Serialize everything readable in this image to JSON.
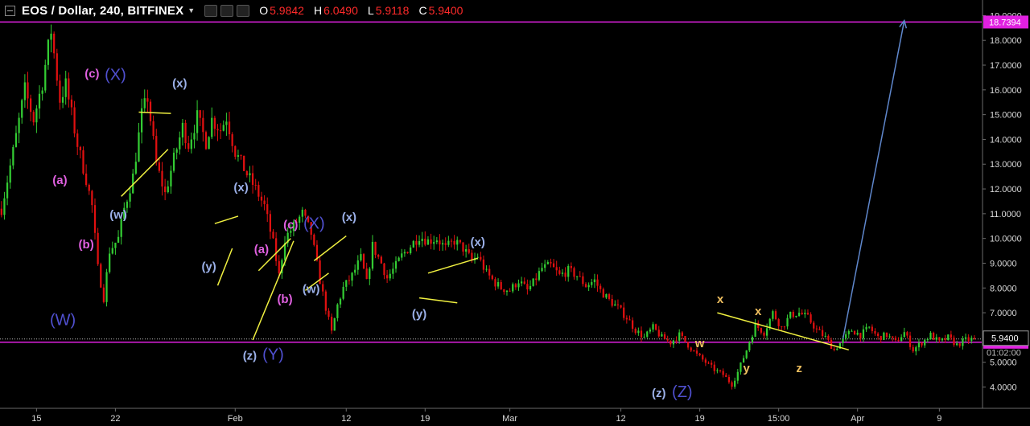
{
  "header": {
    "symbol": "EOS / Dollar, 240, BITFINEX",
    "ohlc": [
      {
        "key": "O",
        "value": "5.9842"
      },
      {
        "key": "H",
        "value": "6.0490"
      },
      {
        "key": "L",
        "value": "5.9118"
      },
      {
        "key": "C",
        "value": "5.9400"
      }
    ]
  },
  "colors": {
    "background": "#000000",
    "bull": "#33cc33",
    "bear": "#e01010",
    "magenta_line": "#e020e0",
    "trendline": "#f0f040",
    "projection": "#5f87cc",
    "label_pink": "#e060e0",
    "label_blue": "#9bb0e8",
    "label_big_blue": "#5050d0",
    "label_orange": "#f0c060"
  },
  "chart_data": {
    "type": "candlestick",
    "title": "EOS / Dollar, 240, BITFINEX",
    "y_scale": "linear",
    "ylim": [
      3.4,
      19.5
    ],
    "yticks": [
      "4.0000",
      "5.0000",
      "6.0000",
      "7.0000",
      "8.0000",
      "9.0000",
      "10.0000",
      "11.0000",
      "12.0000",
      "13.0000",
      "14.0000",
      "15.0000",
      "16.0000",
      "17.0000",
      "18.0000",
      "19.0000"
    ],
    "xticks": [
      "15",
      "22",
      "Feb",
      "12",
      "19",
      "Mar",
      "12",
      "19",
      "15:00",
      "Apr",
      "9"
    ],
    "price_levels": [
      {
        "name": "upper",
        "value": 18.7394,
        "label": "18.7394"
      },
      {
        "name": "lower",
        "value": 5.8087,
        "label": "5.8087"
      }
    ],
    "last_price": {
      "value": 5.94,
      "label": "5.9400"
    },
    "countdown": "01:02:00",
    "path_points": [
      [
        0,
        11.2
      ],
      [
        4,
        13.5
      ],
      [
        8,
        16.0
      ],
      [
        11,
        14.8
      ],
      [
        14,
        16.3
      ],
      [
        17,
        18.4
      ],
      [
        20,
        15.6
      ],
      [
        22,
        16.2
      ],
      [
        26,
        13.8
      ],
      [
        29,
        12.4
      ],
      [
        31,
        11.3
      ],
      [
        33,
        8.8
      ],
      [
        35,
        7.6
      ],
      [
        37,
        9.5
      ],
      [
        40,
        10.0
      ],
      [
        42,
        11.2
      ],
      [
        45,
        12.5
      ],
      [
        48,
        15.0
      ],
      [
        50,
        15.7
      ],
      [
        53,
        13.0
      ],
      [
        56,
        11.8
      ],
      [
        59,
        13.2
      ],
      [
        62,
        14.5
      ],
      [
        64,
        13.8
      ],
      [
        67,
        14.9
      ],
      [
        70,
        13.9
      ],
      [
        72,
        14.8
      ],
      [
        75,
        14.4
      ],
      [
        77,
        14.9
      ],
      [
        80,
        13.5
      ],
      [
        84,
        12.6
      ],
      [
        87,
        12.0
      ],
      [
        90,
        11.3
      ],
      [
        93,
        9.8
      ],
      [
        95,
        8.5
      ],
      [
        97,
        10.0
      ],
      [
        100,
        10.5
      ],
      [
        103,
        11.0
      ],
      [
        106,
        10.2
      ],
      [
        109,
        8.3
      ],
      [
        111,
        7.2
      ],
      [
        113,
        6.2
      ],
      [
        115,
        7.3
      ],
      [
        117,
        8.0
      ],
      [
        120,
        8.5
      ],
      [
        123,
        9.2
      ],
      [
        125,
        8.2
      ],
      [
        127,
        9.7
      ],
      [
        130,
        9.0
      ],
      [
        132,
        8.4
      ],
      [
        135,
        8.9
      ],
      [
        137,
        9.3
      ],
      [
        140,
        9.7
      ],
      [
        143,
        10.1
      ],
      [
        146,
        9.9
      ],
      [
        149,
        10.0
      ],
      [
        152,
        9.6
      ],
      [
        155,
        9.9
      ],
      [
        158,
        9.6
      ],
      [
        161,
        9.1
      ],
      [
        163,
        9.3
      ],
      [
        166,
        8.6
      ],
      [
        169,
        8.2
      ],
      [
        171,
        8.0
      ],
      [
        174,
        7.9
      ],
      [
        177,
        8.3
      ],
      [
        180,
        7.9
      ],
      [
        182,
        8.2
      ],
      [
        185,
        8.8
      ],
      [
        188,
        8.9
      ],
      [
        191,
        8.5
      ],
      [
        194,
        8.7
      ],
      [
        197,
        8.5
      ],
      [
        200,
        8.1
      ],
      [
        203,
        8.3
      ],
      [
        205,
        7.9
      ],
      [
        208,
        7.5
      ],
      [
        211,
        7.2
      ],
      [
        214,
        6.8
      ],
      [
        217,
        6.3
      ],
      [
        220,
        6.0
      ],
      [
        223,
        6.4
      ],
      [
        226,
        6.0
      ],
      [
        229,
        5.8
      ],
      [
        232,
        6.1
      ],
      [
        235,
        5.7
      ],
      [
        238,
        5.3
      ],
      [
        241,
        5.0
      ],
      [
        244,
        4.7
      ],
      [
        247,
        4.5
      ],
      [
        250,
        4.1
      ],
      [
        252,
        4.6
      ],
      [
        255,
        5.5
      ],
      [
        258,
        6.5
      ],
      [
        261,
        6.2
      ],
      [
        264,
        7.0
      ],
      [
        267,
        6.4
      ],
      [
        270,
        6.9
      ],
      [
        273,
        7.0
      ],
      [
        276,
        6.8
      ],
      [
        279,
        6.3
      ],
      [
        282,
        6.0
      ],
      [
        285,
        5.5
      ],
      [
        288,
        5.9
      ],
      [
        291,
        6.3
      ],
      [
        294,
        6.1
      ],
      [
        297,
        6.4
      ],
      [
        300,
        6.0
      ],
      [
        303,
        6.1
      ],
      [
        306,
        5.8
      ],
      [
        309,
        6.2
      ],
      [
        312,
        5.5
      ],
      [
        315,
        5.8
      ],
      [
        318,
        6.1
      ],
      [
        321,
        5.8
      ],
      [
        324,
        6.0
      ],
      [
        327,
        5.7
      ],
      [
        330,
        5.9
      ],
      [
        333,
        5.94
      ]
    ],
    "trendlines": [
      [
        [
          47,
          15.1
        ],
        [
          58,
          15.05
        ]
      ],
      [
        [
          41,
          11.7
        ],
        [
          57,
          13.6
        ]
      ],
      [
        [
          73,
          10.6
        ],
        [
          81,
          10.9
        ]
      ],
      [
        [
          74,
          8.1
        ],
        [
          79,
          9.6
        ]
      ],
      [
        [
          86,
          5.9
        ],
        [
          100,
          9.9
        ]
      ],
      [
        [
          88,
          8.7
        ],
        [
          99,
          10.0
        ]
      ],
      [
        [
          104,
          7.9
        ],
        [
          112,
          8.6
        ]
      ],
      [
        [
          107,
          9.1
        ],
        [
          118,
          10.1
        ]
      ],
      [
        [
          146,
          8.6
        ],
        [
          163,
          9.2
        ]
      ],
      [
        [
          143,
          7.6
        ],
        [
          156,
          7.4
        ]
      ],
      [
        [
          245,
          7.0
        ],
        [
          290,
          5.5
        ]
      ]
    ],
    "projection": [
      [
        288,
        5.94
      ],
      [
        309,
        18.8
      ]
    ],
    "wave_labels": [
      {
        "text": "(c)",
        "x": 31,
        "y": 16.5,
        "style": "pink"
      },
      {
        "text": "(X)",
        "x": 39,
        "y": 16.4,
        "style": "bigblue"
      },
      {
        "text": "(x)",
        "x": 61,
        "y": 16.1,
        "style": "blue"
      },
      {
        "text": "(a)",
        "x": 20,
        "y": 12.2,
        "style": "pink"
      },
      {
        "text": "(w)",
        "x": 40,
        "y": 10.8,
        "style": "blue"
      },
      {
        "text": "(b)",
        "x": 29,
        "y": 9.6,
        "style": "pink"
      },
      {
        "text": "(W)",
        "x": 21,
        "y": 6.5,
        "style": "bigblue"
      },
      {
        "text": "(x)",
        "x": 82,
        "y": 11.9,
        "style": "blue"
      },
      {
        "text": "(y)",
        "x": 71,
        "y": 8.7,
        "style": "blue"
      },
      {
        "text": "(c)",
        "x": 99,
        "y": 10.4,
        "style": "pink"
      },
      {
        "text": "(X)",
        "x": 107,
        "y": 10.4,
        "style": "bigblue"
      },
      {
        "text": "(x)",
        "x": 119,
        "y": 10.7,
        "style": "blue"
      },
      {
        "text": "(a)",
        "x": 89,
        "y": 9.4,
        "style": "pink"
      },
      {
        "text": "(w)",
        "x": 106,
        "y": 7.8,
        "style": "blue"
      },
      {
        "text": "(b)",
        "x": 97,
        "y": 7.4,
        "style": "pink"
      },
      {
        "text": "(z)",
        "x": 85,
        "y": 5.1,
        "style": "blue"
      },
      {
        "text": "(Y)",
        "x": 93,
        "y": 5.1,
        "style": "bigblue"
      },
      {
        "text": "(x)",
        "x": 163,
        "y": 9.7,
        "style": "blue"
      },
      {
        "text": "(y)",
        "x": 143,
        "y": 6.8,
        "style": "blue"
      },
      {
        "text": "x",
        "x": 246,
        "y": 7.4,
        "style": "orange"
      },
      {
        "text": "x",
        "x": 259,
        "y": 6.9,
        "style": "orange"
      },
      {
        "text": "w",
        "x": 239,
        "y": 5.6,
        "style": "orange"
      },
      {
        "text": "y",
        "x": 255,
        "y": 4.6,
        "style": "orange"
      },
      {
        "text": "z",
        "x": 273,
        "y": 4.6,
        "style": "orange"
      },
      {
        "text": "(z)",
        "x": 225,
        "y": 3.6,
        "style": "blue"
      },
      {
        "text": "(Z)",
        "x": 233,
        "y": 3.6,
        "style": "bigblue"
      }
    ],
    "grid": false,
    "legend": "none"
  }
}
